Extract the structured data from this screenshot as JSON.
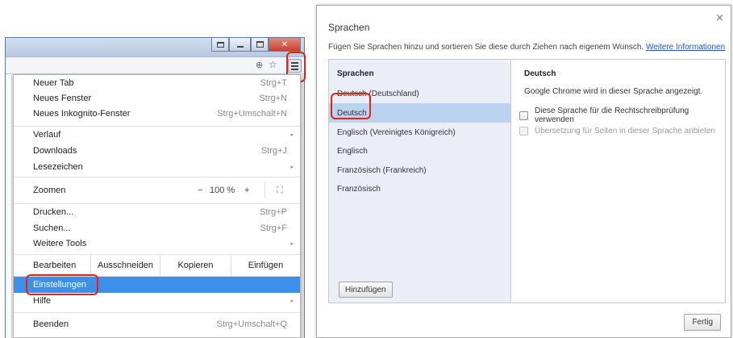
{
  "chrome": {
    "window_buttons": {
      "minimize": "–",
      "close": "✕"
    },
    "toolbar_icons": [
      "zoom-icon",
      "star-icon",
      "menu-icon"
    ],
    "menu": {
      "new_tab": {
        "label": "Neuer Tab",
        "shortcut": "Strg+T"
      },
      "new_window": {
        "label": "Neues Fenster",
        "shortcut": "Strg+N"
      },
      "incognito": {
        "label": "Neues Inkognito-Fenster",
        "shortcut": "Strg+Umschalt+N"
      },
      "history": {
        "label": "Verlauf"
      },
      "downloads": {
        "label": "Downloads",
        "shortcut": "Strg+J"
      },
      "bookmarks": {
        "label": "Lesezeichen"
      },
      "zoom": {
        "label": "Zoomen",
        "minus": "−",
        "value": "100 %",
        "plus": "+",
        "fullscreen": "⛶"
      },
      "print": {
        "label": "Drucken...",
        "shortcut": "Strg+P"
      },
      "find": {
        "label": "Suchen...",
        "shortcut": "Strg+F"
      },
      "more_tools": {
        "label": "Weitere Tools"
      },
      "edit": {
        "label": "Bearbeiten",
        "cut": "Ausschneiden",
        "copy": "Kopieren",
        "paste": "Einfügen"
      },
      "settings": {
        "label": "Einstellungen"
      },
      "help": {
        "label": "Hilfe"
      },
      "exit": {
        "label": "Beenden",
        "shortcut": "Strg+Umschalt+Q"
      },
      "submenu_arrow": "▸"
    },
    "highlight_color": "#e2231a",
    "active_color": "#3d8fe8"
  },
  "dialog": {
    "title": "Sprachen",
    "close": "×",
    "description": "Fügen Sie Sprachen hinzu und sortieren Sie diese durch Ziehen nach eigenem Wunsch.",
    "more_info_link": "Weitere Informationen",
    "languages_header": "Sprachen",
    "languages": [
      "Deutsch (Deutschland)",
      "Deutsch",
      "Englisch (Vereinigtes Königreich)",
      "Englisch",
      "Französisch (Frankreich)",
      "Französisch"
    ],
    "selected_language": "Deutsch",
    "add_button": "Hinzufügen",
    "detail": {
      "header": "Deutsch",
      "info": "Google Chrome wird in dieser Sprache angezeigt.",
      "spellcheck": "Diese Sprache für die Rechtschreibprüfung verwenden",
      "translate": "Übersetzung für Seiten in dieser Sprache anbieten"
    },
    "done_button": "Fertig"
  }
}
